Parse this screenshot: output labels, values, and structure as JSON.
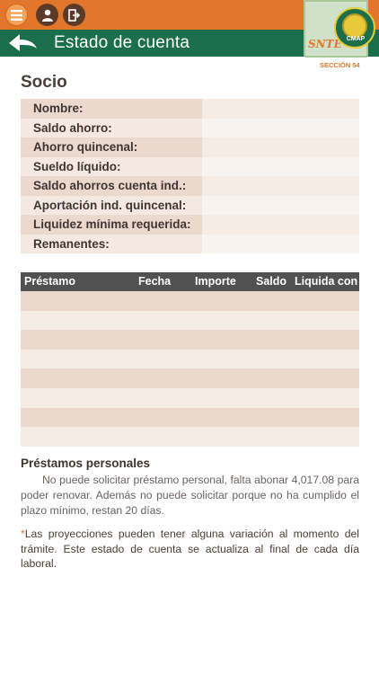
{
  "header": {
    "title": "Estado de cuenta",
    "logo": {
      "brand": "SNTE",
      "seal_text": "CMAP",
      "section": "SECCIÓN 54"
    },
    "icons": [
      "menu-icon",
      "user-icon",
      "logout-icon",
      "back-arrow-icon"
    ]
  },
  "socio": {
    "title": "Socio",
    "rows": [
      {
        "label": "Nombre:",
        "value": ""
      },
      {
        "label": "Saldo ahorro:",
        "value": ""
      },
      {
        "label": "Ahorro quincenal:",
        "value": ""
      },
      {
        "label": "Sueldo líquido:",
        "value": ""
      },
      {
        "label": "Saldo ahorros cuenta ind.:",
        "value": ""
      },
      {
        "label": "Aportación ind. quincenal:",
        "value": ""
      },
      {
        "label": "Liquidez mínima requerida:",
        "value": ""
      },
      {
        "label": "Remanentes:",
        "value": ""
      }
    ]
  },
  "loans": {
    "columns": [
      "Préstamo",
      "Fecha",
      "Importe",
      "Saldo",
      "Liquida con"
    ],
    "rows": 8
  },
  "personal_loans": {
    "title": "Préstamos personales",
    "text": "No puede solicitar préstamo personal, falta abonar 4,017.08 para poder renovar. Además no puede solicitar porque no ha cumplido el plazo mínimo, restan 20 días."
  },
  "note": {
    "star": "*",
    "text": "Las proyecciones pueden tener alguna variación al momento del trámite. Este estado de cuenta se actualiza al final de cada día laboral."
  },
  "colors": {
    "orange": "#e2762a",
    "green": "#1b6e4a",
    "header_dark": "#515151",
    "row_dark": "#ecd9cd",
    "row_light": "#f6ece6"
  }
}
